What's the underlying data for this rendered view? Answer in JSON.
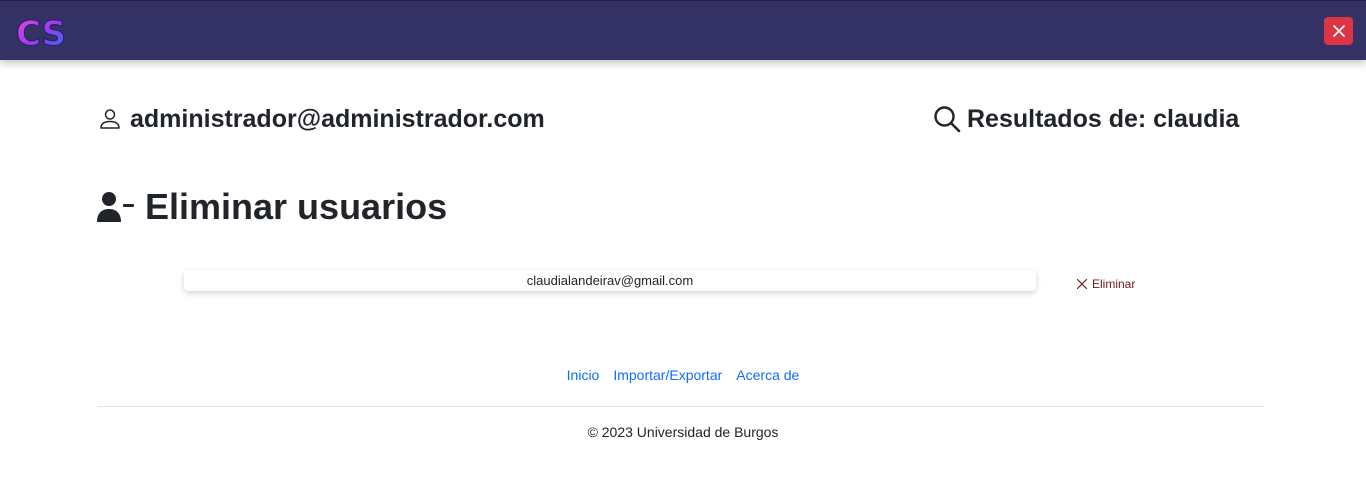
{
  "header": {
    "logo_text": "CS",
    "close_icon": "close-icon"
  },
  "user": {
    "email": "administrador@administrador.com",
    "icon": "person-icon"
  },
  "search": {
    "label": "Resultados de: claudia",
    "icon": "search-icon"
  },
  "page": {
    "title": "Eliminar usuarios",
    "icon": "user-minus-icon"
  },
  "users": [
    {
      "email": "claudialandeirav@gmail.com",
      "delete_label": "Eliminar"
    }
  ],
  "footer": {
    "links": [
      "Inicio",
      "Importar/Exportar",
      "Acerca de"
    ],
    "copyright": "© 2023 Universidad de Burgos"
  },
  "colors": {
    "navbar": "#343264",
    "close_button": "#dc3545",
    "link": "#0d6efd",
    "delete_text": "#6b1a1a"
  }
}
